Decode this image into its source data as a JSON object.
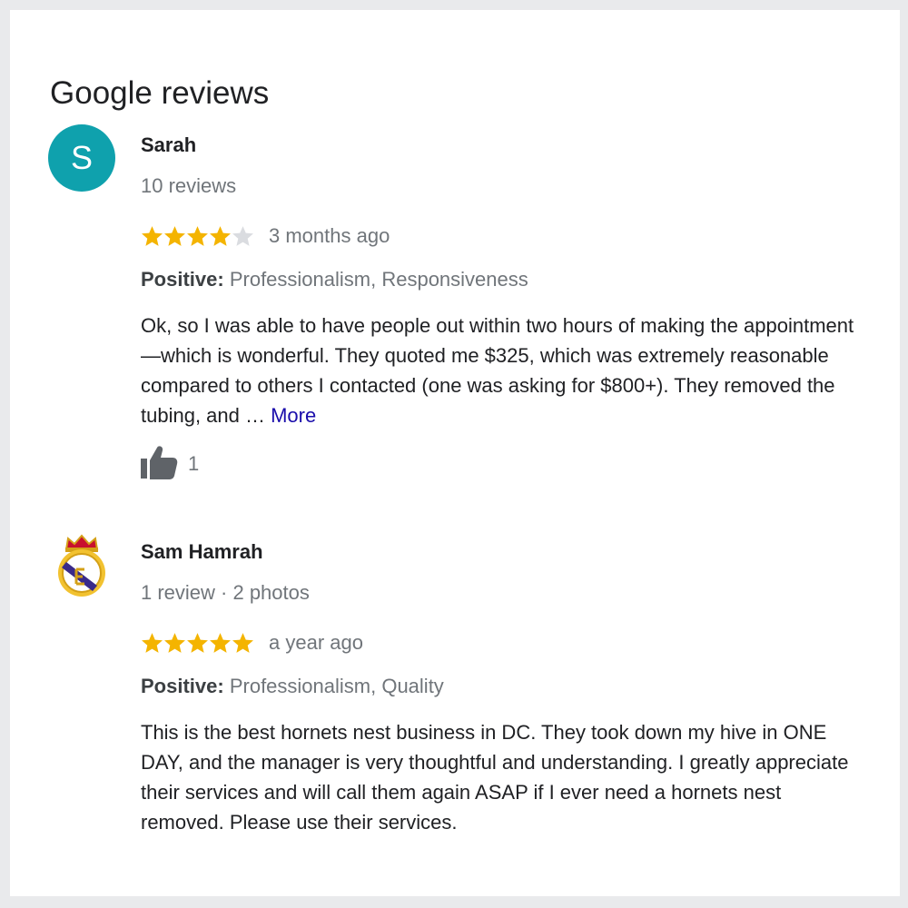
{
  "heading": "Google reviews",
  "colors": {
    "star_filled": "#f4b400",
    "star_empty": "#dadce0",
    "avatar_bg": "#0fa1ad",
    "link": "#1a0dab"
  },
  "reviews": [
    {
      "avatar_letter": "S",
      "name": "Sarah",
      "meta": "10 reviews",
      "rating": 4,
      "time": "3 months ago",
      "positive_label": "Positive:",
      "positive_values": "Professionalism, Responsiveness",
      "text": "Ok, so I was able to have people out within two hours of making the appointment—which is wonderful. They quoted me $325, which was extremely reasonable compared to others I contacted (one was asking for $800+). They removed the tubing, and … ",
      "more_label": "More",
      "like_icon": "thumbs-up-icon",
      "likes": "1"
    },
    {
      "avatar_icon": "crest-icon",
      "name": "Sam Hamrah",
      "meta": "1 review · 2 photos",
      "rating": 5,
      "time": "a year ago",
      "positive_label": "Positive:",
      "positive_values": "Professionalism, Quality",
      "text": "This is the best hornets nest business in DC. They took down my hive in ONE DAY, and the manager is very thoughtful and understanding. I greatly appreciate their services and will call them again ASAP if I ever need a hornets nest removed. Please use their services."
    }
  ]
}
